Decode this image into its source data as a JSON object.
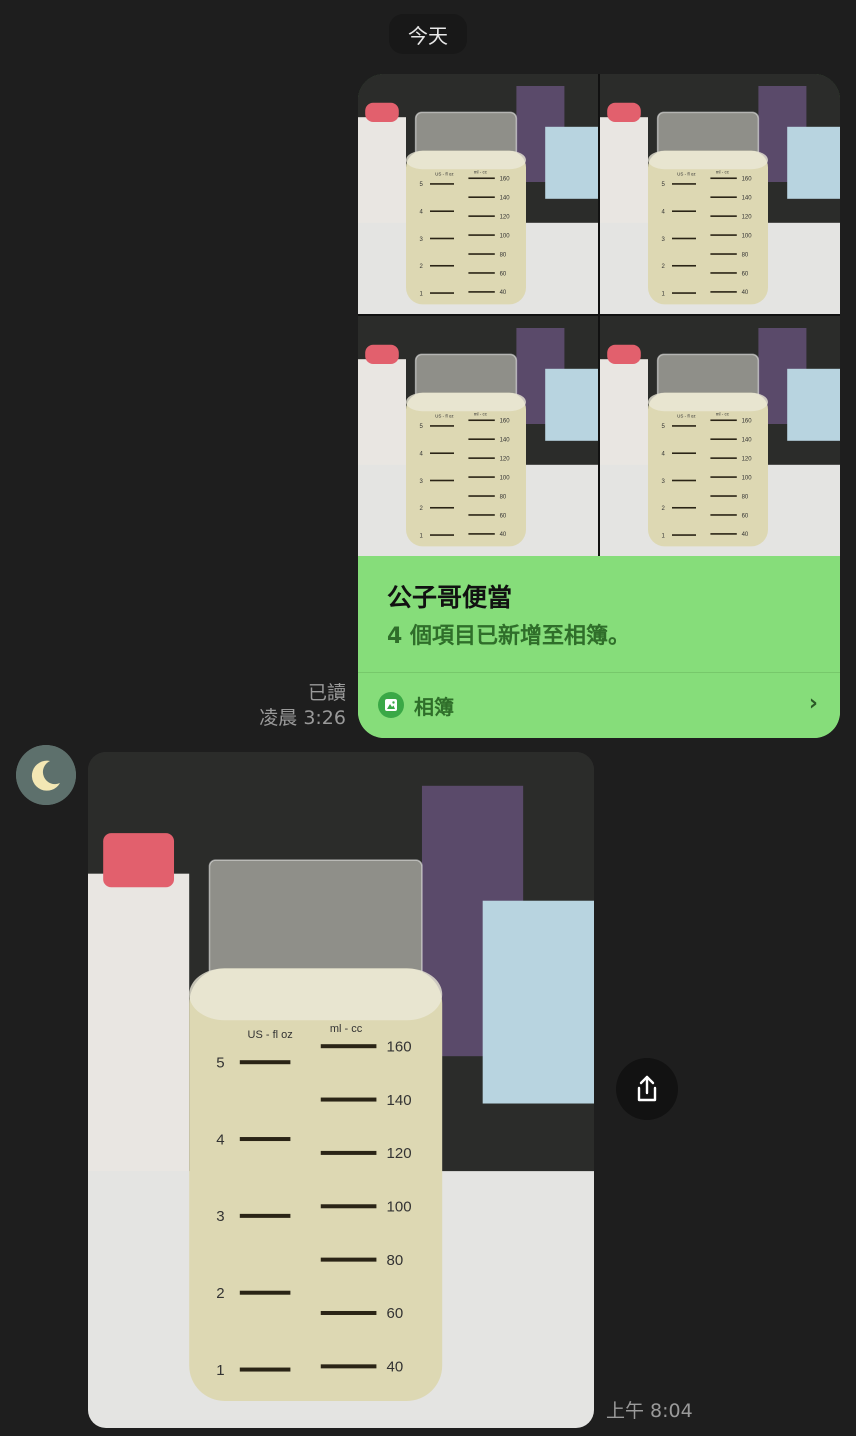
{
  "chat": {
    "date_divider": "今天",
    "sent": {
      "read_status": "已讀",
      "time": "凌晨 3:26",
      "album_card": {
        "title": "公子哥便當",
        "subtitle": "4 個項目已新增至相簿。",
        "footer_label": "相簿",
        "photo_count": 4,
        "accent_color": "#86dd7a"
      }
    },
    "received": {
      "time": "上午 8:04"
    }
  },
  "bottle_markings": {
    "oz_header": "US - fl oz",
    "ml_header": "ml - cc",
    "oz_ticks": [
      "5",
      "4",
      "3",
      "2",
      "1"
    ],
    "ml_ticks": [
      "160",
      "140",
      "120",
      "100",
      "80",
      "60",
      "40"
    ]
  },
  "icons": {
    "avatar": "crescent-moon-icon",
    "share": "share-icon",
    "album": "album-icon",
    "chevron": "chevron-right-icon"
  }
}
